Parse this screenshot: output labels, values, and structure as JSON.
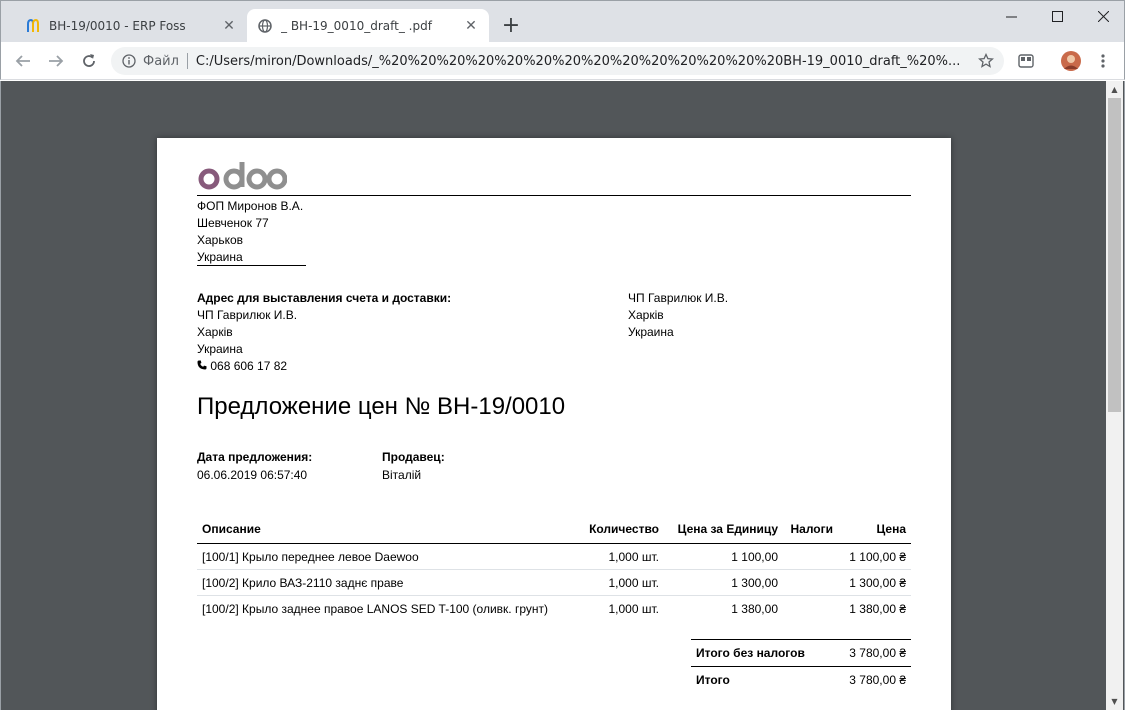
{
  "browser": {
    "tabs": [
      {
        "label": "ВН-19/0010 - ERP Foss",
        "active": false
      },
      {
        "label": "_ ВН-19_0010_draft_ .pdf",
        "active": true
      }
    ],
    "omnibox": {
      "scheme_label": "Файл",
      "url": "C:/Users/miron/Downloads/_%20%20%20%20%20%20%20%20%20%20%20%20%20%20ВН-19_0010_draft_%20%..."
    }
  },
  "document": {
    "logo_text": "odoo",
    "company": {
      "name": "ФОП Миронов В.А.",
      "street": "Шевченок 77",
      "city": "Харьков",
      "country": "Украина"
    },
    "billing": {
      "heading": "Адрес для выставления счета и доставки:",
      "name": "ЧП Гаврилюк И.В.",
      "city": "Харків",
      "country": "Украина",
      "phone": "068 606 17 82"
    },
    "shipping": {
      "name": "ЧП Гаврилюк И.В.",
      "city": "Харків",
      "country": "Украина"
    },
    "title": "Предложение цен № ВН-19/0010",
    "date_label": "Дата предложения:",
    "date_value": "06.06.2019 06:57:40",
    "seller_label": "Продавец:",
    "seller_value": "Віталій",
    "table": {
      "headers": {
        "description": "Описание",
        "quantity": "Количество",
        "unit_price": "Цена за Единицу",
        "taxes": "Налоги",
        "price": "Цена"
      },
      "rows": [
        {
          "description": "[100/1] Крыло переднее левое Daewoo",
          "quantity": "1,000 шт.",
          "unit_price": "1 100,00",
          "taxes": "",
          "price": "1 100,00 ₴"
        },
        {
          "description": "[100/2] Крило ВАЗ-2110 заднє праве",
          "quantity": "1,000 шт.",
          "unit_price": "1 300,00",
          "taxes": "",
          "price": "1 300,00 ₴"
        },
        {
          "description": "[100/2] Крыло заднее правое LANOS SED T-100 (оливк. грунт)",
          "quantity": "1,000 шт.",
          "unit_price": "1 380,00",
          "taxes": "",
          "price": "1 380,00 ₴"
        }
      ]
    },
    "totals": {
      "untaxed_label": "Итого без налогов",
      "untaxed_value": "3 780,00 ₴",
      "total_label": "Итого",
      "total_value": "3 780,00 ₴"
    }
  },
  "colors": {
    "logo_o": "#875a7b",
    "logo_rest": "#8f8f8f",
    "viewer_bg": "#525659"
  }
}
